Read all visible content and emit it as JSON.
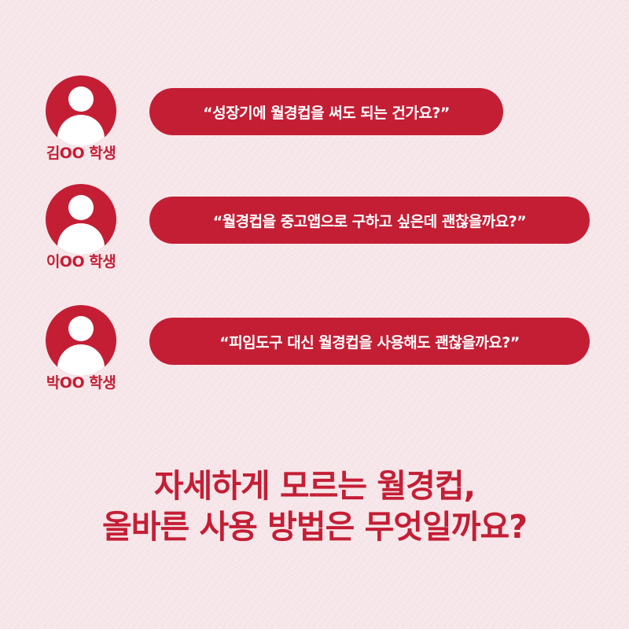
{
  "colors": {
    "background": "#f6e6e9",
    "accent": "#c41e35",
    "bubble_text": "#ffffff"
  },
  "questions": [
    {
      "student": "김OO 학생",
      "avatar_icon": "user-icon",
      "text": "“성장기에 월경컵을 써도 되는 건가요?”"
    },
    {
      "student": "이OO 학생",
      "avatar_icon": "user-icon",
      "text": "“월경컵을 중고앱으로 구하고 싶은데 괜찮을까요?”"
    },
    {
      "student": "박OO 학생",
      "avatar_icon": "user-icon",
      "text": "“피임도구 대신 월경컵을 사용해도 괜찮을까요?”"
    }
  ],
  "headline": {
    "line1": "자세하게 모르는 월경컵,",
    "line2": "올바른 사용 방법은 무엇일까요?"
  }
}
